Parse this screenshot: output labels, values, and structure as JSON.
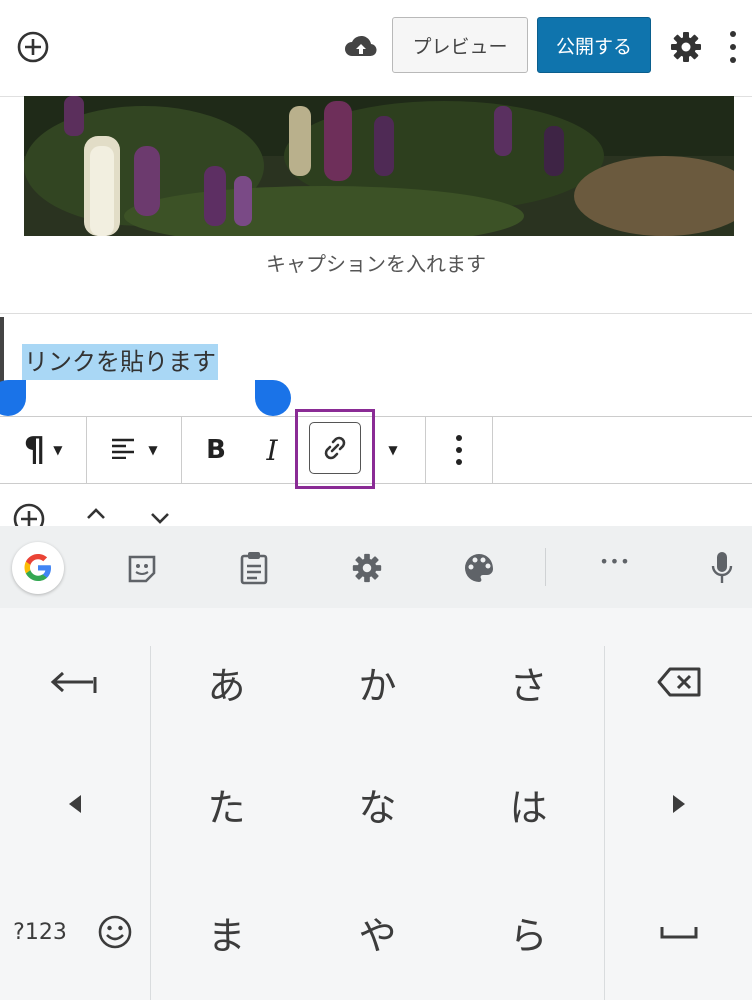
{
  "topbar": {
    "add_icon": "add-block-icon",
    "cloud_icon": "cloud-upload-icon",
    "preview_label": "プレビュー",
    "publish_label": "公開する",
    "settings_icon": "gear-icon",
    "more_icon": "more-vertical-icon"
  },
  "content": {
    "caption": "キャプションを入れます",
    "paragraph": "リンクを貼ります"
  },
  "format_toolbar": {
    "paragraph_icon": "¶",
    "bold_label": "B",
    "italic_label": "I"
  },
  "keyboard_bar": {
    "items": [
      "google-icon",
      "sticker-icon",
      "clipboard-icon",
      "settings-icon",
      "palette-icon",
      "more-icon",
      "mic-icon"
    ],
    "more_label": "•••"
  },
  "keyboard": {
    "row1": [
      "あ",
      "か",
      "さ"
    ],
    "row2": [
      "た",
      "な",
      "は"
    ],
    "row3": [
      "ま",
      "や",
      "ら"
    ],
    "mode_label": "?123",
    "space_label": "␣"
  },
  "colors": {
    "publish": "#0f74ad",
    "selection": "#a9d7f5",
    "handle": "#1a73e8",
    "highlight": "#8a2b95"
  }
}
